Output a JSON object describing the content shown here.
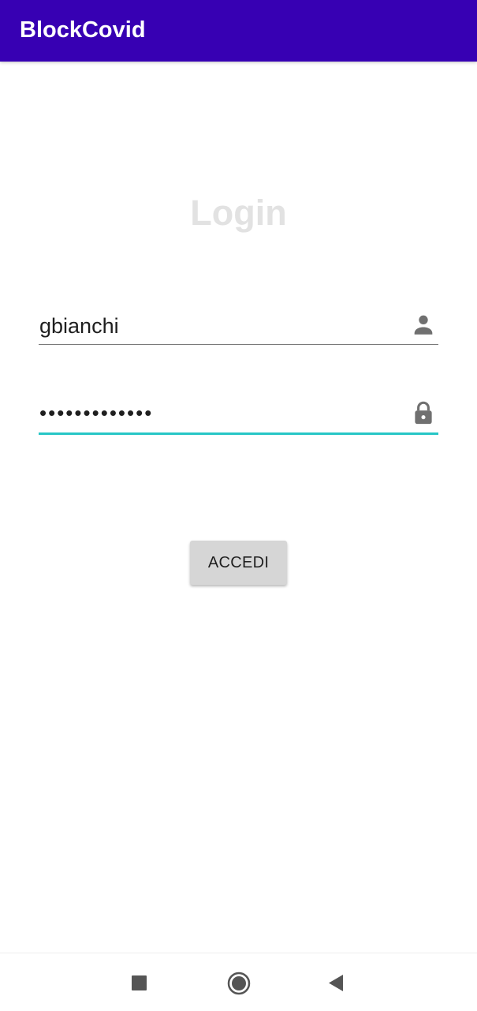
{
  "app_bar": {
    "title": "BlockCovid",
    "color": "#3700b3"
  },
  "login": {
    "heading": "Login",
    "username": {
      "value": "gbianchi",
      "icon": "person-icon"
    },
    "password": {
      "masked_value": "•••••••••••••",
      "icon": "lock-icon",
      "focused": true,
      "focus_color": "#26c6c6"
    },
    "submit_label": "ACCEDI"
  },
  "nav_bar": {
    "icons": [
      "stop-square-icon",
      "home-circle-icon",
      "back-triangle-icon"
    ]
  }
}
